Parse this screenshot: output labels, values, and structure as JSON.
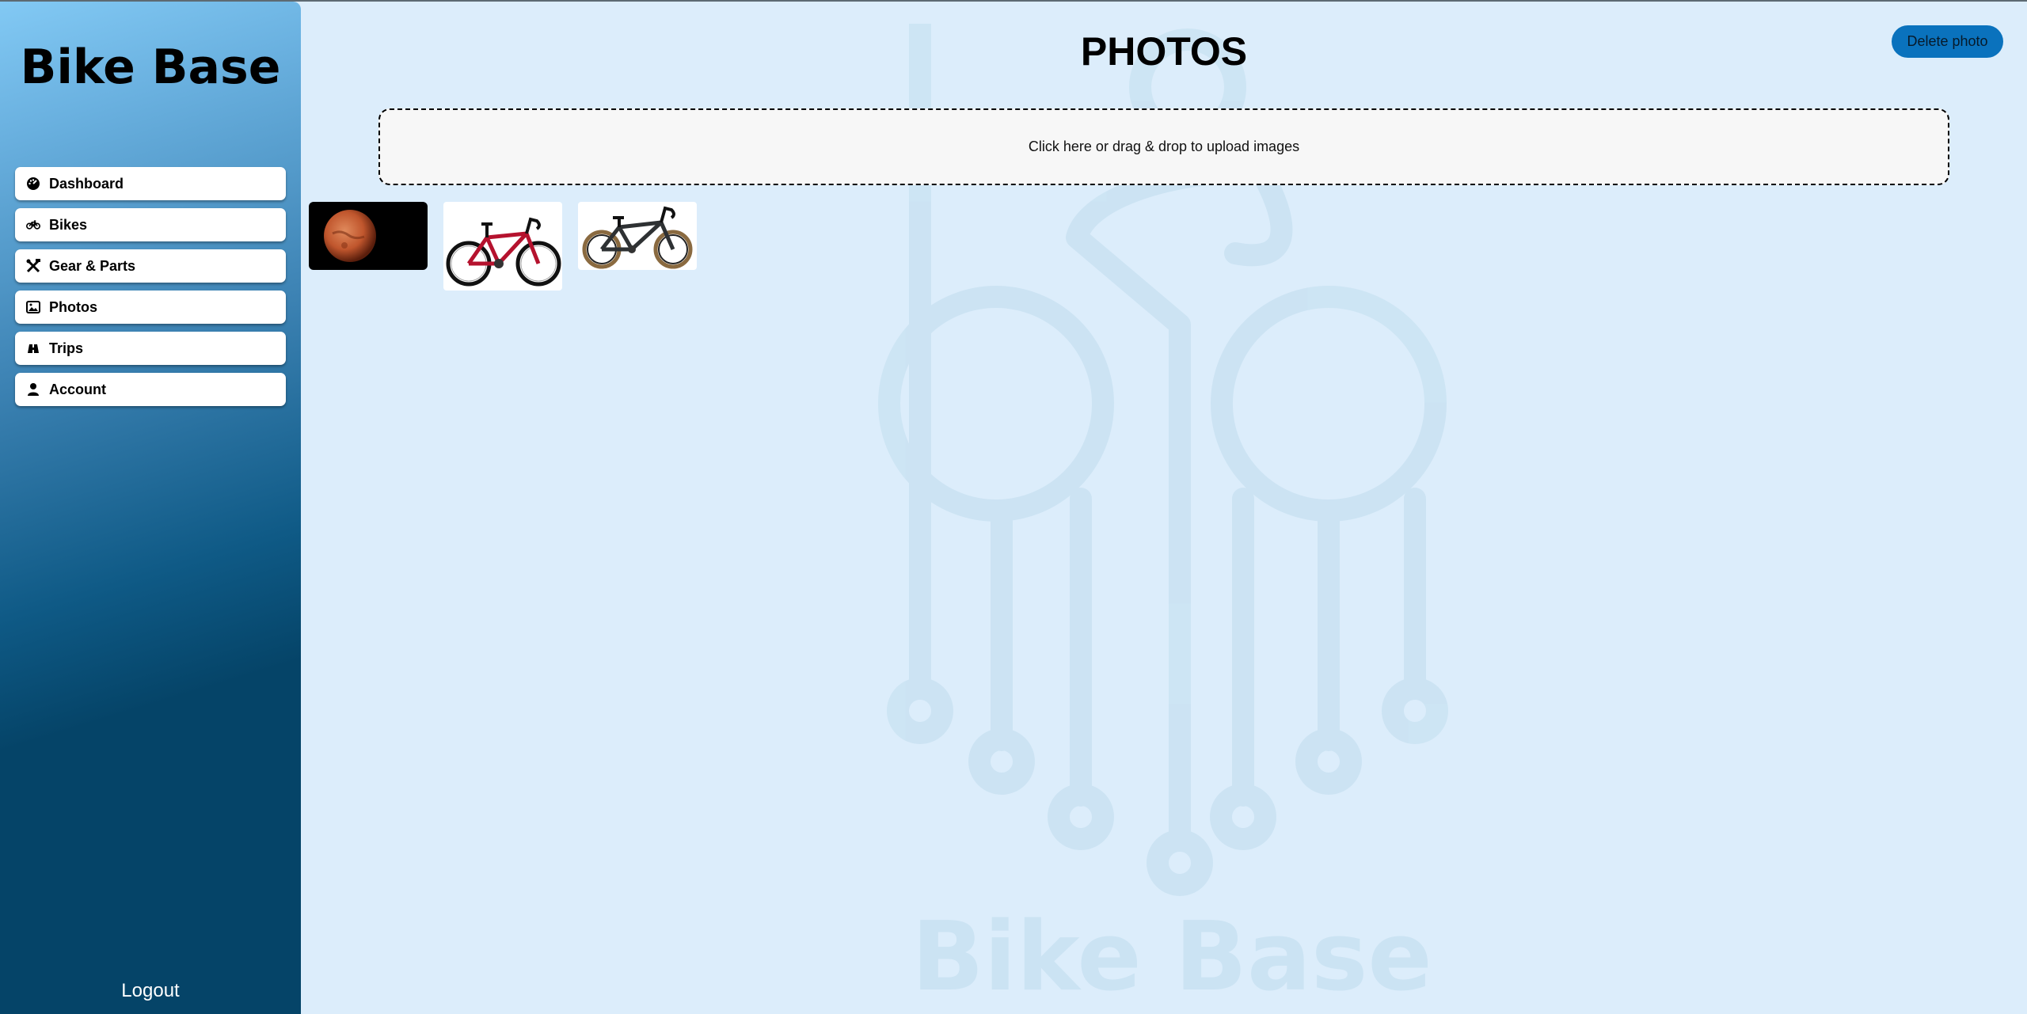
{
  "sidebar": {
    "brand": "Bike Base",
    "items": [
      {
        "label": "Dashboard",
        "icon": "dashboard-icon"
      },
      {
        "label": "Bikes",
        "icon": "bike-icon"
      },
      {
        "label": "Gear & Parts",
        "icon": "tools-icon"
      },
      {
        "label": "Photos",
        "icon": "image-icon"
      },
      {
        "label": "Trips",
        "icon": "binoculars-icon"
      },
      {
        "label": "Account",
        "icon": "user-icon"
      }
    ],
    "logout": "Logout"
  },
  "main": {
    "title": "PHOTOS",
    "delete_label": "Delete photo",
    "dropzone_text": "Click here or drag & drop to upload images",
    "watermark_text": "Bike Base",
    "photos": [
      {
        "subject": "mars-planet"
      },
      {
        "subject": "red-road-bike"
      },
      {
        "subject": "grey-gravel-bike"
      }
    ]
  },
  "colors": {
    "background": "#dcedfb",
    "accent": "#0a72bd",
    "sidebar_top": "#82c9f4",
    "sidebar_bottom": "#054468"
  }
}
